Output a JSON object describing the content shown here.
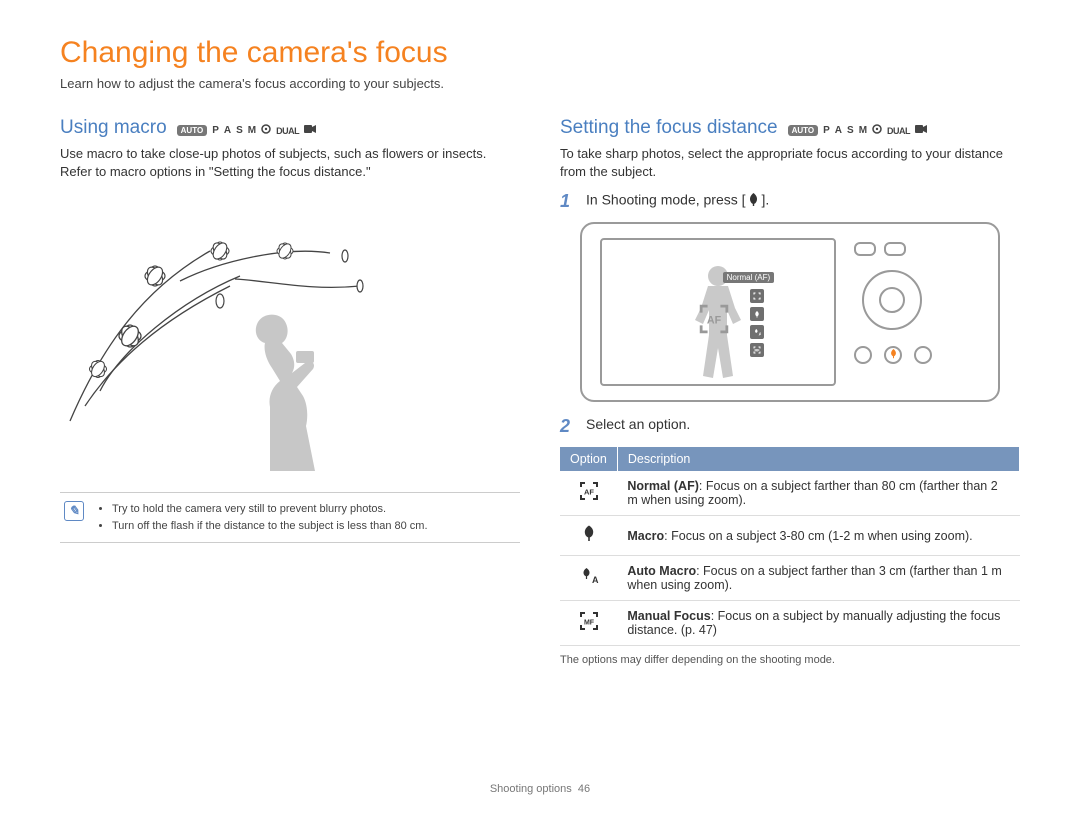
{
  "title": "Changing the camera's focus",
  "intro": "Learn how to adjust the camera's focus according to your subjects.",
  "modes_row": {
    "auto": "AUTO",
    "p": "P",
    "a": "A",
    "s": "S",
    "m": "M",
    "dual": "DUAL"
  },
  "left": {
    "heading": "Using macro",
    "body": "Use macro to take close-up photos of subjects, such as flowers or insects. Refer to macro options in \"Setting the focus distance.\"",
    "note1": "Try to hold the camera very still to prevent blurry photos.",
    "note2": "Turn off the flash if the distance to the subject is less than 80 cm."
  },
  "right": {
    "heading": "Setting the focus distance",
    "body": "To take sharp photos, select the appropriate focus according to your distance from the subject.",
    "step1_num": "1",
    "step1_pre": "In Shooting mode, press [",
    "step1_post": "].",
    "camera_tip": "Normal (AF)",
    "step2_num": "2",
    "step2_text": "Select an option.",
    "table": {
      "h_option": "Option",
      "h_desc": "Description",
      "r1_bold": "Normal (AF)",
      "r1_text": ": Focus on a subject farther than 80 cm (farther than 2 m when using zoom).",
      "r2_bold": "Macro",
      "r2_text": ": Focus on a subject 3-80 cm (1-2 m when using zoom).",
      "r3_bold": "Auto Macro",
      "r3_text": ": Focus on a subject farther than 3 cm (farther than 1 m when using zoom).",
      "r4_bold": "Manual Focus",
      "r4_text": ": Focus on a subject by manually adjusting the focus distance. (p. 47)"
    },
    "foot_note": "The options may differ depending on the shooting mode."
  },
  "footer": {
    "chapter": "Shooting options",
    "page_num": "46"
  }
}
